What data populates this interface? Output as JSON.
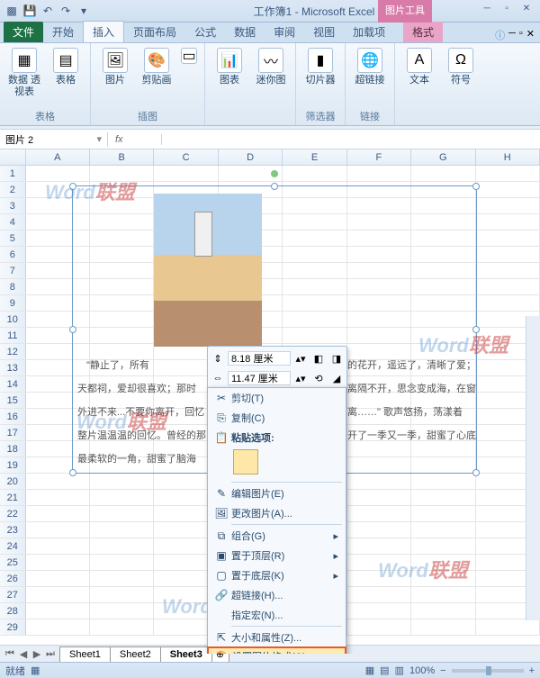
{
  "title": "工作簿1 - Microsoft Excel",
  "contextual_tab_title": "图片工具",
  "qat": {
    "save": "💾",
    "undo": "↶",
    "redo": "↷",
    "dd": "▾"
  },
  "tabs": {
    "file": "文件",
    "items": [
      "开始",
      "插入",
      "页面布局",
      "公式",
      "数据",
      "审阅",
      "视图",
      "加载项"
    ],
    "format": "格式"
  },
  "ribbon": {
    "groups": [
      {
        "label": "表格",
        "items": [
          {
            "name": "pivot",
            "label": "数据\n透视表",
            "icon": "▦"
          },
          {
            "name": "table",
            "label": "表格",
            "icon": "▤"
          }
        ]
      },
      {
        "label": "插图",
        "items": [
          {
            "name": "picture",
            "label": "图片",
            "icon": "🖼"
          },
          {
            "name": "clipart",
            "label": "剪贴画",
            "icon": "🎨"
          },
          {
            "name": "shapes",
            "label": "",
            "icon": "▭"
          }
        ]
      },
      {
        "label": "",
        "items": [
          {
            "name": "chart",
            "label": "图表",
            "icon": "📊"
          },
          {
            "name": "sparkline",
            "label": "迷你图",
            "icon": "〰"
          }
        ]
      },
      {
        "label": "筛选器",
        "items": [
          {
            "name": "slicer",
            "label": "切片器",
            "icon": "▮"
          }
        ]
      },
      {
        "label": "链接",
        "items": [
          {
            "name": "hyperlink",
            "label": "超链接",
            "icon": "🌐"
          }
        ]
      },
      {
        "label": "",
        "items": [
          {
            "name": "textbox",
            "label": "文本",
            "icon": "A"
          },
          {
            "name": "symbol",
            "label": "符号",
            "icon": "Ω"
          }
        ]
      }
    ]
  },
  "namebox": "图片 2",
  "fx": "fx",
  "cols": [
    "A",
    "B",
    "C",
    "D",
    "E",
    "F",
    "G",
    "H"
  ],
  "rows_from": 1,
  "rows_to": 29,
  "mini": {
    "h": "8.18 厘米",
    "w": "11.47 厘米"
  },
  "ctx": {
    "cut": "剪切(T)",
    "copy": "复制(C)",
    "paste_opts": "粘贴选项:",
    "edit_pic": "编辑图片(E)",
    "change_pic": "更改图片(A)...",
    "group": "组合(G)",
    "bring_front": "置于顶层(R)",
    "send_back": "置于底层(K)",
    "hyperlink": "超链接(H)...",
    "macro": "指定宏(N)...",
    "size_props": "大小和属性(Z)...",
    "format_pic": "设置图片格式(O)..."
  },
  "text_snips": {
    "t1": "\"静止了，所有",
    "t2": "的花开，遥远了，清晰了爱；",
    "t3": "天都祠，爱却很喜欢；那时",
    "t4": "离隔不开，思念变成海，在窗",
    "t5": "外进不来...不要你离开，回忆",
    "t6": "离……\" 歌声悠扬，荡漾着",
    "t7": "整片温温温的回忆。曾经的那",
    "t8": "开了一季又一季，甜蜜了心底",
    "t9": "最柔软的一角，甜蜜了脑海"
  },
  "sheets": [
    "Sheet1",
    "Sheet2",
    "Sheet3"
  ],
  "status": {
    "ready": "就绪",
    "zoom": "100%"
  },
  "watermark": "Word联盟"
}
